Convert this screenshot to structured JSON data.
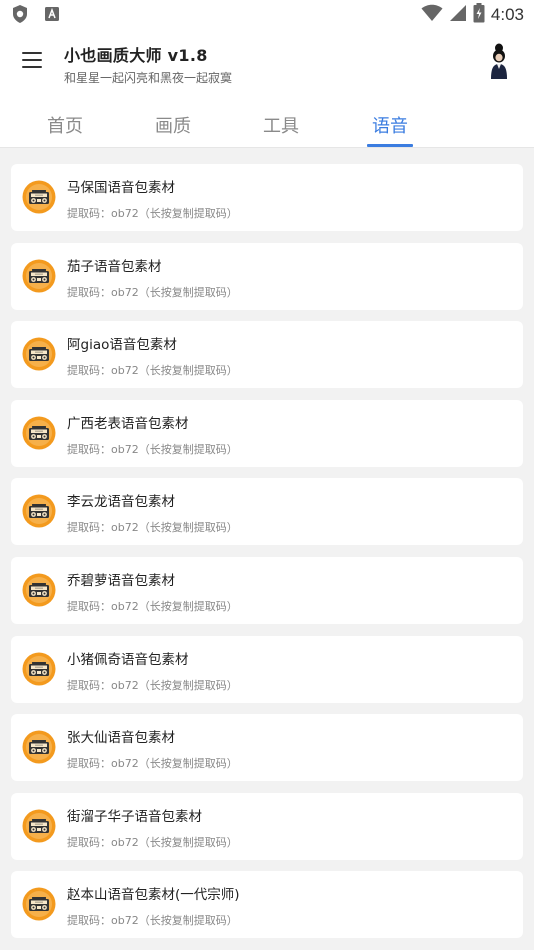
{
  "status_bar": {
    "time": "4:03",
    "icons": [
      "shield-icon",
      "font-a-icon",
      "wifi-icon",
      "signal-icon",
      "battery-charging-icon"
    ]
  },
  "header": {
    "title": "小也画质大师 v1.8",
    "subtitle": "和星星一起闪亮和黑夜一起寂寞",
    "menu_icon": "hamburger-menu-icon",
    "avatar_icon": "user-avatar-icon"
  },
  "tabs": [
    {
      "label": "首页",
      "active": false
    },
    {
      "label": "画质",
      "active": false
    },
    {
      "label": "工具",
      "active": false
    },
    {
      "label": "语音",
      "active": true
    }
  ],
  "colors": {
    "accent": "#3b7de0",
    "icon_orange": "#f39a1e",
    "background": "#f2f2f2"
  },
  "list": {
    "item_icon": "radio-cassette-icon",
    "items": [
      {
        "title": "马保国语音包素材",
        "subtitle": "提取码：ob72（长按复制提取码）"
      },
      {
        "title": "茄子语音包素材",
        "subtitle": "提取码：ob72（长按复制提取码）"
      },
      {
        "title": "阿giao语音包素材",
        "subtitle": "提取码：ob72（长按复制提取码）"
      },
      {
        "title": "广西老表语音包素材",
        "subtitle": "提取码：ob72（长按复制提取码）"
      },
      {
        "title": "李云龙语音包素材",
        "subtitle": "提取码：ob72（长按复制提取码）"
      },
      {
        "title": "乔碧萝语音包素材",
        "subtitle": "提取码：ob72（长按复制提取码）"
      },
      {
        "title": "小猪佩奇语音包素材",
        "subtitle": "提取码：ob72（长按复制提取码）"
      },
      {
        "title": "张大仙语音包素材",
        "subtitle": "提取码：ob72（长按复制提取码）"
      },
      {
        "title": "街溜子华子语音包素材",
        "subtitle": "提取码：ob72（长按复制提取码）"
      },
      {
        "title": "赵本山语音包素材(一代宗师)",
        "subtitle": "提取码：ob72（长按复制提取码）"
      }
    ]
  }
}
